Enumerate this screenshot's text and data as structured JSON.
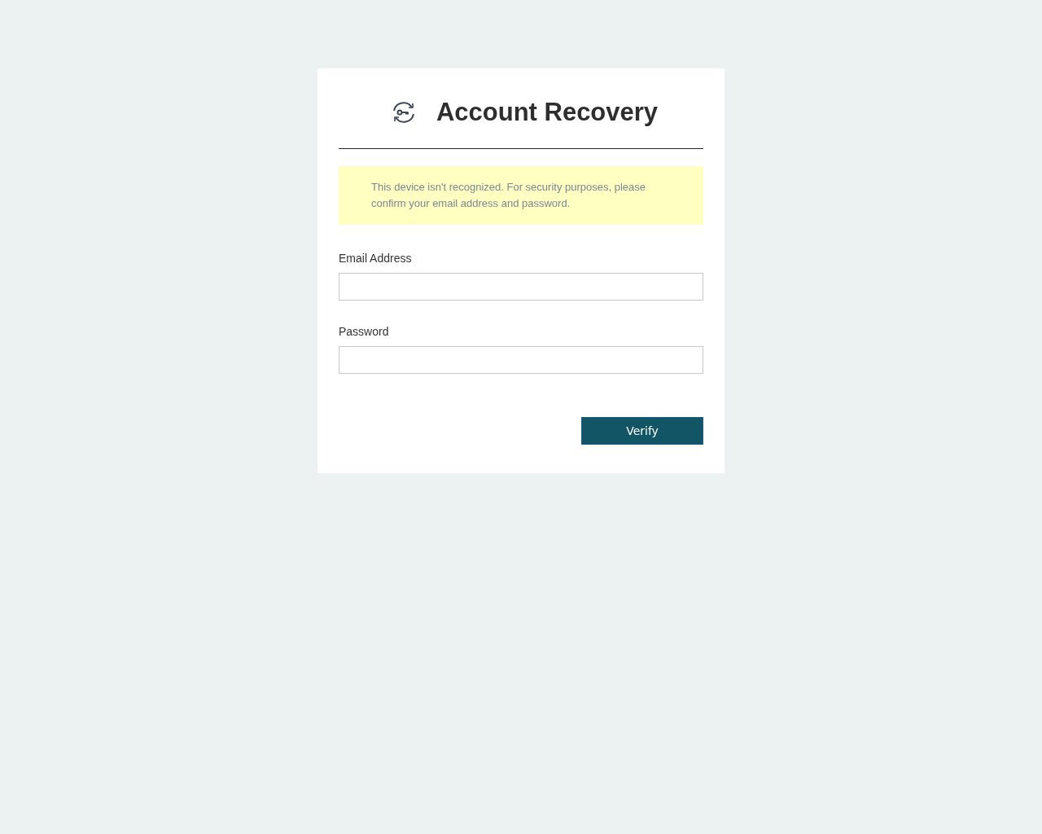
{
  "title": "Account Recovery",
  "notice": "This device isn't recognized. For security purposes, please confirm your email address and password.",
  "fields": [
    {
      "label": "Email Address"
    },
    {
      "label": "Password"
    }
  ],
  "button": "Verify"
}
